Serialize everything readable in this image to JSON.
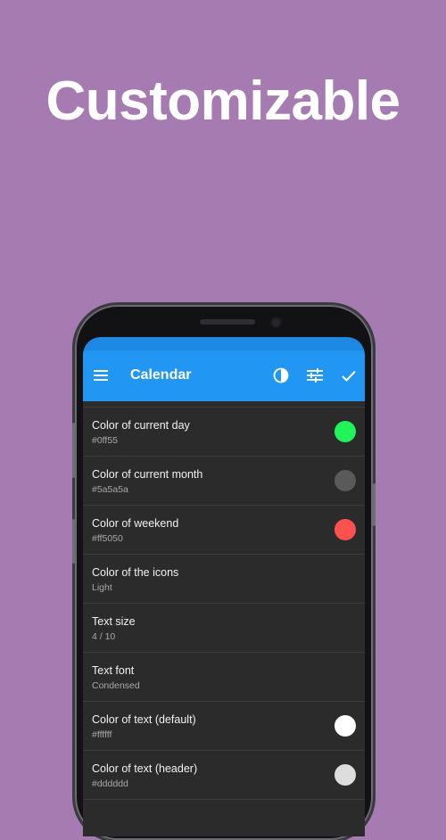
{
  "headline": "Customizable",
  "appbar": {
    "title": "Calendar",
    "menu_icon": "menu-icon",
    "theme_icon": "contrast-icon",
    "settings_icon": "tune-icon",
    "confirm_icon": "check-icon"
  },
  "settings": [
    {
      "title": "Color of current day",
      "subtitle": "#0ff55",
      "swatch": "#1ff55b"
    },
    {
      "title": "Color of current month",
      "subtitle": "#5a5a5a",
      "swatch": "#5a5a5a"
    },
    {
      "title": "Color of weekend",
      "subtitle": "#ff5050",
      "swatch": "#ff5050"
    },
    {
      "title": "Color of the icons",
      "subtitle": "Light",
      "swatch": null
    },
    {
      "title": "Text size",
      "subtitle": "4 / 10",
      "swatch": null
    },
    {
      "title": "Text font",
      "subtitle": "Condensed",
      "swatch": null
    },
    {
      "title": "Color of text (default)",
      "subtitle": "#ffffff",
      "swatch": "#ffffff"
    },
    {
      "title": "Color of text (header)",
      "subtitle": "#dddddd",
      "swatch": "#dddddd"
    }
  ],
  "colors": {
    "background": "#a67bb1",
    "appbar": "#2196f3",
    "list_bg": "#2b2b2b"
  }
}
